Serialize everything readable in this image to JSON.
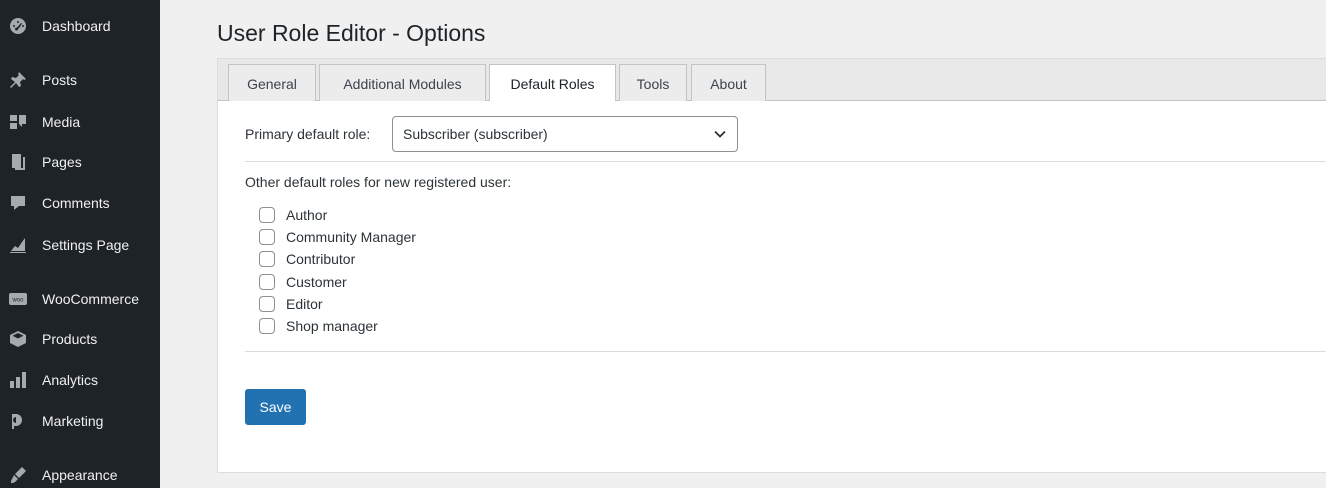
{
  "sidebar": {
    "items": [
      {
        "label": "Dashboard",
        "icon": "dashboard-icon"
      },
      {
        "label": "Posts",
        "icon": "pin-icon"
      },
      {
        "label": "Media",
        "icon": "media-icon"
      },
      {
        "label": "Pages",
        "icon": "pages-icon"
      },
      {
        "label": "Comments",
        "icon": "comment-icon"
      },
      {
        "label": "Settings Page",
        "icon": "chart-icon"
      },
      {
        "label": "WooCommerce",
        "icon": "woo-icon"
      },
      {
        "label": "Products",
        "icon": "box-icon"
      },
      {
        "label": "Analytics",
        "icon": "bar-chart-icon"
      },
      {
        "label": "Marketing",
        "icon": "megaphone-icon"
      },
      {
        "label": "Appearance",
        "icon": "brush-icon"
      }
    ]
  },
  "page": {
    "title": "User Role Editor - Options"
  },
  "tabs": [
    {
      "label": "General",
      "active": false
    },
    {
      "label": "Additional Modules",
      "active": false
    },
    {
      "label": "Default Roles",
      "active": true
    },
    {
      "label": "Tools",
      "active": false
    },
    {
      "label": "About",
      "active": false
    }
  ],
  "form": {
    "primary_label": "Primary default role:",
    "primary_value": "Subscriber (subscriber)",
    "other_label": "Other default roles for new registered user:",
    "roles": [
      {
        "label": "Author",
        "checked": false
      },
      {
        "label": "Community Manager",
        "checked": false
      },
      {
        "label": "Contributor",
        "checked": false
      },
      {
        "label": "Customer",
        "checked": false
      },
      {
        "label": "Editor",
        "checked": false
      },
      {
        "label": "Shop manager",
        "checked": false
      }
    ],
    "save_label": "Save"
  },
  "colors": {
    "sidebar_bg": "#1d2327",
    "primary_button": "#2271b1"
  }
}
